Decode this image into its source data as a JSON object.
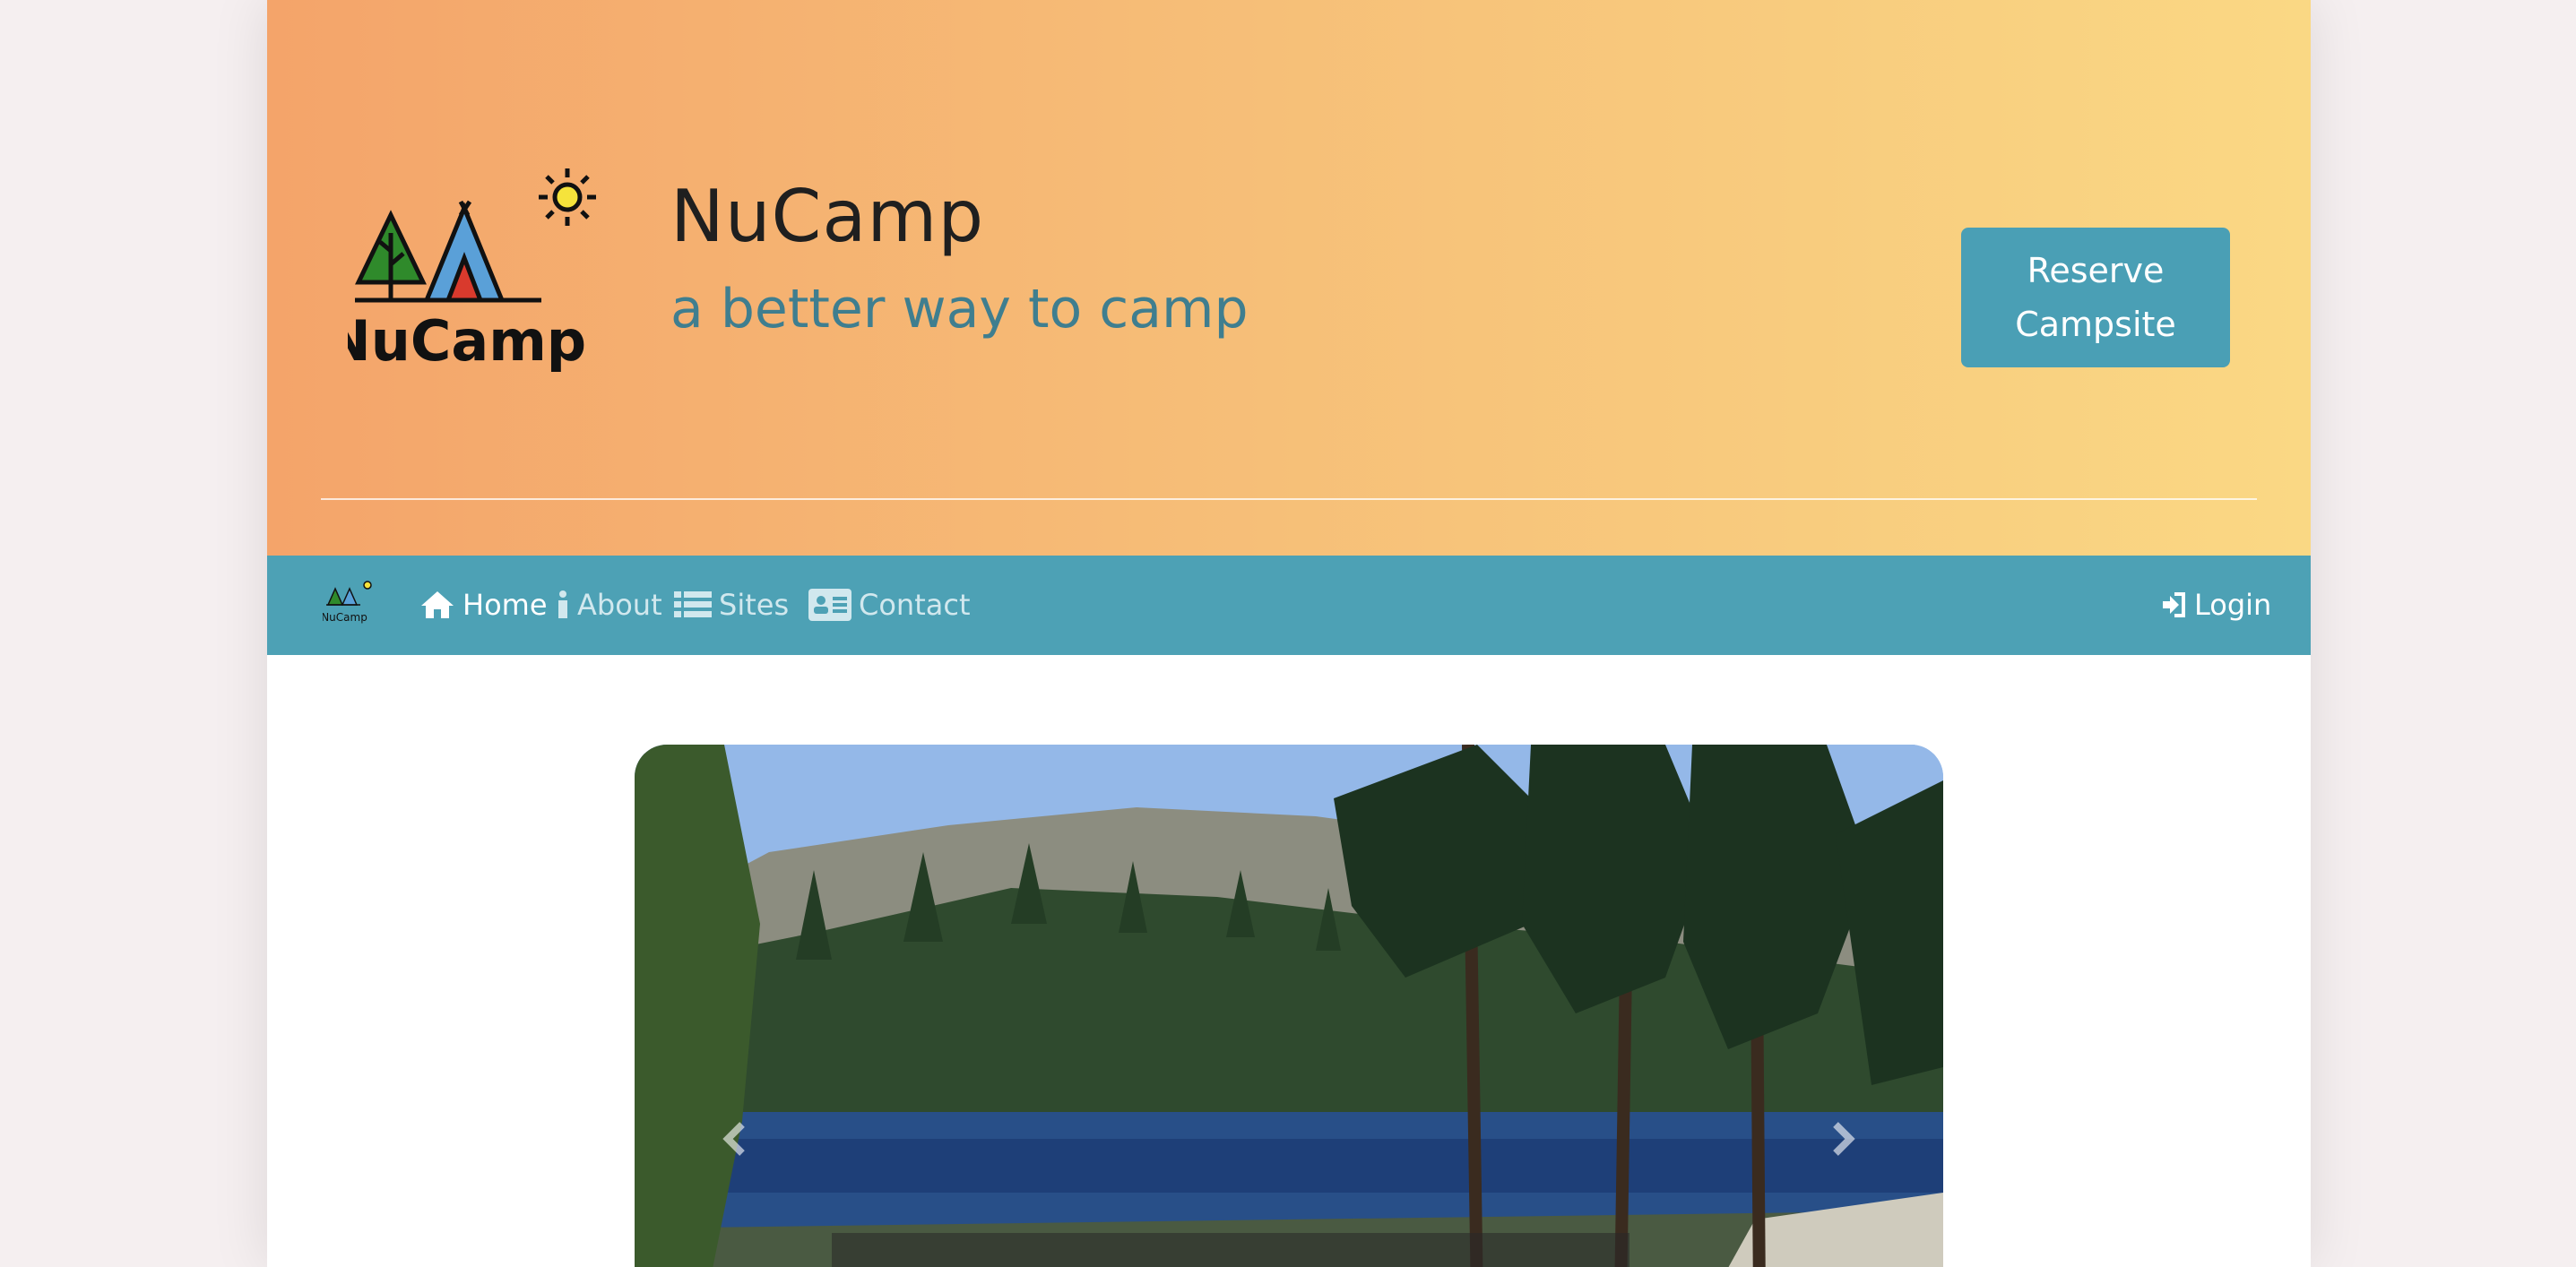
{
  "brand": {
    "title": "NuCamp",
    "tagline": "a better way to camp",
    "logo_text": "NuCamp",
    "logo_small_text": "NuCamp"
  },
  "header": {
    "reserve_button": "Reserve Campsite"
  },
  "nav": {
    "items": [
      {
        "label": "Home",
        "icon": "home-icon",
        "active": true
      },
      {
        "label": "About",
        "icon": "info-icon",
        "active": false
      },
      {
        "label": "Sites",
        "icon": "list-icon",
        "active": false
      },
      {
        "label": "Contact",
        "icon": "address-card-icon",
        "active": false
      }
    ],
    "login": {
      "label": "Login",
      "icon": "sign-in-icon"
    }
  },
  "carousel": {
    "prev_icon": "chevron-left-icon",
    "next_icon": "chevron-right-icon"
  },
  "colors": {
    "gradient_start": "#f4a46a",
    "gradient_end": "#fad884",
    "accent": "#4a9fb5",
    "tagline": "#3f7e8f"
  }
}
